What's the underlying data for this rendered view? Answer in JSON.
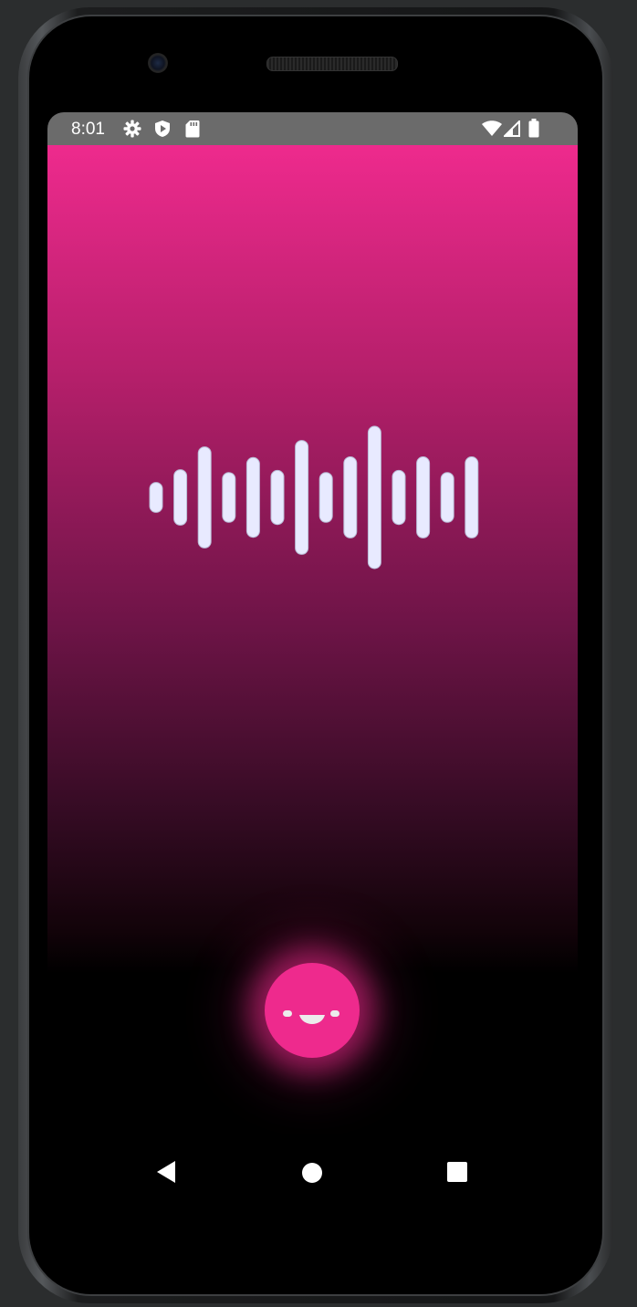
{
  "status_bar": {
    "time": "8:01",
    "left_icons": [
      "gear-icon",
      "shield-play-icon",
      "sd-card-icon"
    ],
    "right_icons": [
      "wifi-icon",
      "cell-signal-icon",
      "battery-icon"
    ]
  },
  "app": {
    "background_gradient": [
      "#ee2a8d",
      "#000000"
    ],
    "accent_color": "#ee2a8d",
    "waveform_color": "#e8eaff",
    "waveform_levels": [
      0.21,
      0.39,
      0.71,
      0.35,
      0.56,
      0.38,
      0.8,
      0.35,
      0.57,
      1.0,
      0.38,
      0.57,
      0.35,
      0.57
    ],
    "assistant_button": {
      "icon": "smiling-face-icon"
    }
  },
  "nav_bar": {
    "buttons": [
      "back-icon",
      "home-icon",
      "recents-icon"
    ]
  }
}
